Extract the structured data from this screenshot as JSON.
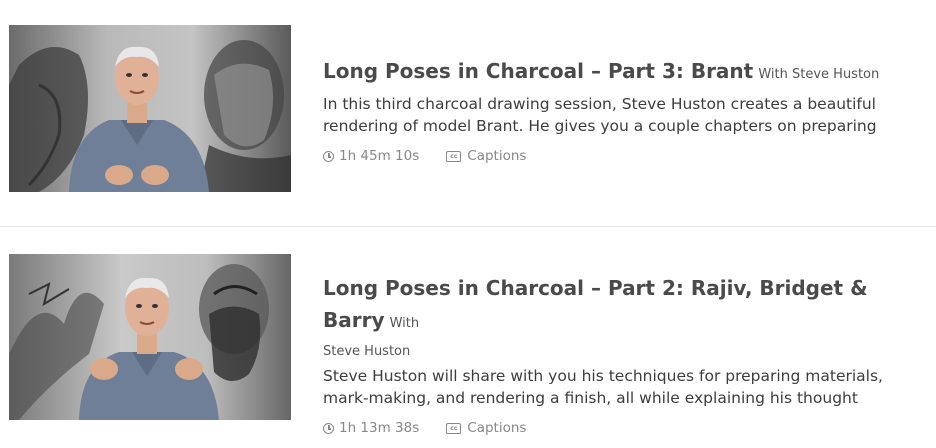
{
  "courses": [
    {
      "title": "Long Poses in Charcoal – Part 3: Brant",
      "with_prefix": "With",
      "author": "Steve Huston",
      "description": "In this third charcoal drawing session, Steve Huston creates a beautiful rendering of model Brant. He gives you a couple chapters on preparing",
      "duration": "1h 45m 10s",
      "captions_label": "Captions",
      "thumbnail_icon": "video-thumbnail"
    },
    {
      "title": "Long Poses in Charcoal – Part 2: Rajiv, Bridget & Barry",
      "with_prefix": "With",
      "author": "Steve Huston",
      "description": "Steve Huston will share with you his techniques for preparing materials, mark-making, and rendering a finish, all while explaining his thought",
      "duration": "1h 13m 38s",
      "captions_label": "Captions",
      "thumbnail_icon": "video-thumbnail"
    }
  ],
  "icons": {
    "duration": "clock-icon",
    "captions": "closed-captions-icon"
  },
  "colors": {
    "title": "#4a4a4a",
    "body_text": "#3d3d3d",
    "meta_text": "#888888",
    "divider": "#e6e6e6",
    "shirt": "#6f7f98"
  }
}
